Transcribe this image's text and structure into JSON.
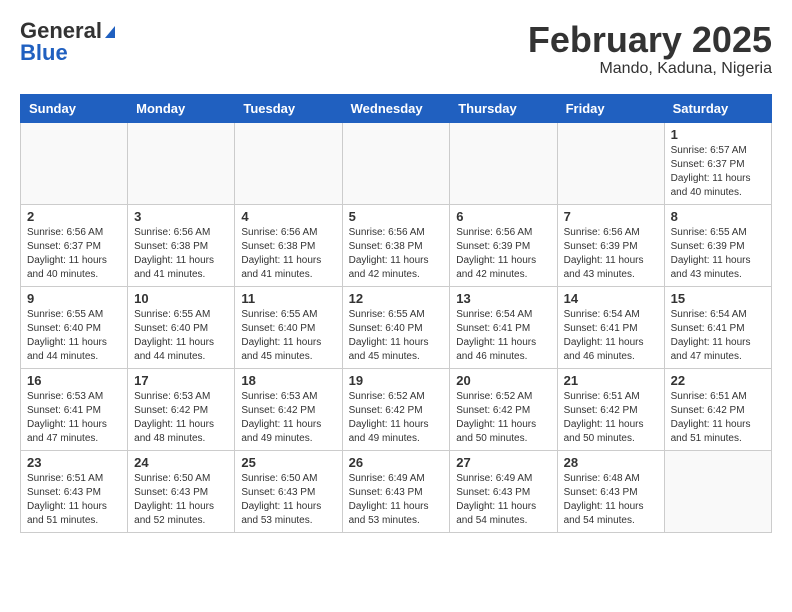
{
  "header": {
    "logo_general": "General",
    "logo_blue": "Blue",
    "month_title": "February 2025",
    "location": "Mando, Kaduna, Nigeria"
  },
  "calendar": {
    "days_of_week": [
      "Sunday",
      "Monday",
      "Tuesday",
      "Wednesday",
      "Thursday",
      "Friday",
      "Saturday"
    ],
    "weeks": [
      [
        {
          "day": "",
          "info": ""
        },
        {
          "day": "",
          "info": ""
        },
        {
          "day": "",
          "info": ""
        },
        {
          "day": "",
          "info": ""
        },
        {
          "day": "",
          "info": ""
        },
        {
          "day": "",
          "info": ""
        },
        {
          "day": "1",
          "info": "Sunrise: 6:57 AM\nSunset: 6:37 PM\nDaylight: 11 hours and 40 minutes."
        }
      ],
      [
        {
          "day": "2",
          "info": "Sunrise: 6:56 AM\nSunset: 6:37 PM\nDaylight: 11 hours and 40 minutes."
        },
        {
          "day": "3",
          "info": "Sunrise: 6:56 AM\nSunset: 6:38 PM\nDaylight: 11 hours and 41 minutes."
        },
        {
          "day": "4",
          "info": "Sunrise: 6:56 AM\nSunset: 6:38 PM\nDaylight: 11 hours and 41 minutes."
        },
        {
          "day": "5",
          "info": "Sunrise: 6:56 AM\nSunset: 6:38 PM\nDaylight: 11 hours and 42 minutes."
        },
        {
          "day": "6",
          "info": "Sunrise: 6:56 AM\nSunset: 6:39 PM\nDaylight: 11 hours and 42 minutes."
        },
        {
          "day": "7",
          "info": "Sunrise: 6:56 AM\nSunset: 6:39 PM\nDaylight: 11 hours and 43 minutes."
        },
        {
          "day": "8",
          "info": "Sunrise: 6:55 AM\nSunset: 6:39 PM\nDaylight: 11 hours and 43 minutes."
        }
      ],
      [
        {
          "day": "9",
          "info": "Sunrise: 6:55 AM\nSunset: 6:40 PM\nDaylight: 11 hours and 44 minutes."
        },
        {
          "day": "10",
          "info": "Sunrise: 6:55 AM\nSunset: 6:40 PM\nDaylight: 11 hours and 44 minutes."
        },
        {
          "day": "11",
          "info": "Sunrise: 6:55 AM\nSunset: 6:40 PM\nDaylight: 11 hours and 45 minutes."
        },
        {
          "day": "12",
          "info": "Sunrise: 6:55 AM\nSunset: 6:40 PM\nDaylight: 11 hours and 45 minutes."
        },
        {
          "day": "13",
          "info": "Sunrise: 6:54 AM\nSunset: 6:41 PM\nDaylight: 11 hours and 46 minutes."
        },
        {
          "day": "14",
          "info": "Sunrise: 6:54 AM\nSunset: 6:41 PM\nDaylight: 11 hours and 46 minutes."
        },
        {
          "day": "15",
          "info": "Sunrise: 6:54 AM\nSunset: 6:41 PM\nDaylight: 11 hours and 47 minutes."
        }
      ],
      [
        {
          "day": "16",
          "info": "Sunrise: 6:53 AM\nSunset: 6:41 PM\nDaylight: 11 hours and 47 minutes."
        },
        {
          "day": "17",
          "info": "Sunrise: 6:53 AM\nSunset: 6:42 PM\nDaylight: 11 hours and 48 minutes."
        },
        {
          "day": "18",
          "info": "Sunrise: 6:53 AM\nSunset: 6:42 PM\nDaylight: 11 hours and 49 minutes."
        },
        {
          "day": "19",
          "info": "Sunrise: 6:52 AM\nSunset: 6:42 PM\nDaylight: 11 hours and 49 minutes."
        },
        {
          "day": "20",
          "info": "Sunrise: 6:52 AM\nSunset: 6:42 PM\nDaylight: 11 hours and 50 minutes."
        },
        {
          "day": "21",
          "info": "Sunrise: 6:51 AM\nSunset: 6:42 PM\nDaylight: 11 hours and 50 minutes."
        },
        {
          "day": "22",
          "info": "Sunrise: 6:51 AM\nSunset: 6:42 PM\nDaylight: 11 hours and 51 minutes."
        }
      ],
      [
        {
          "day": "23",
          "info": "Sunrise: 6:51 AM\nSunset: 6:43 PM\nDaylight: 11 hours and 51 minutes."
        },
        {
          "day": "24",
          "info": "Sunrise: 6:50 AM\nSunset: 6:43 PM\nDaylight: 11 hours and 52 minutes."
        },
        {
          "day": "25",
          "info": "Sunrise: 6:50 AM\nSunset: 6:43 PM\nDaylight: 11 hours and 53 minutes."
        },
        {
          "day": "26",
          "info": "Sunrise: 6:49 AM\nSunset: 6:43 PM\nDaylight: 11 hours and 53 minutes."
        },
        {
          "day": "27",
          "info": "Sunrise: 6:49 AM\nSunset: 6:43 PM\nDaylight: 11 hours and 54 minutes."
        },
        {
          "day": "28",
          "info": "Sunrise: 6:48 AM\nSunset: 6:43 PM\nDaylight: 11 hours and 54 minutes."
        },
        {
          "day": "",
          "info": ""
        }
      ]
    ]
  }
}
